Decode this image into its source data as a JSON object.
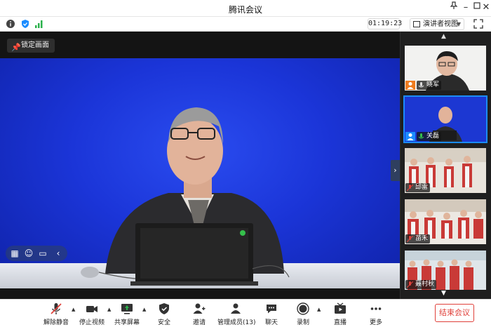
{
  "window": {
    "title": "腾讯会议"
  },
  "infobar": {
    "timer": "01:19:23",
    "view_mode": "演讲者视图"
  },
  "main_video": {
    "lock_label": "锁定画面"
  },
  "participants": [
    {
      "name": "晓军"
    },
    {
      "name": "关磊"
    },
    {
      "name": "邱雷"
    },
    {
      "name": "苗禾"
    },
    {
      "name": "聂村秋"
    }
  ],
  "toolbar": {
    "unmute": "解除静音",
    "stop_video": "停止视频",
    "share_screen": "共享屏幕",
    "security": "安全",
    "invite": "邀请",
    "manage_members": "管理成员(13)",
    "chat": "聊天",
    "record": "录制",
    "live": "直播",
    "more": "更多",
    "end_meeting": "结束会议"
  },
  "colors": {
    "accent": "#1b8cff",
    "danger": "#e0403a",
    "stage_blue": "#1b35d8",
    "signal_green": "#2bb24c"
  }
}
